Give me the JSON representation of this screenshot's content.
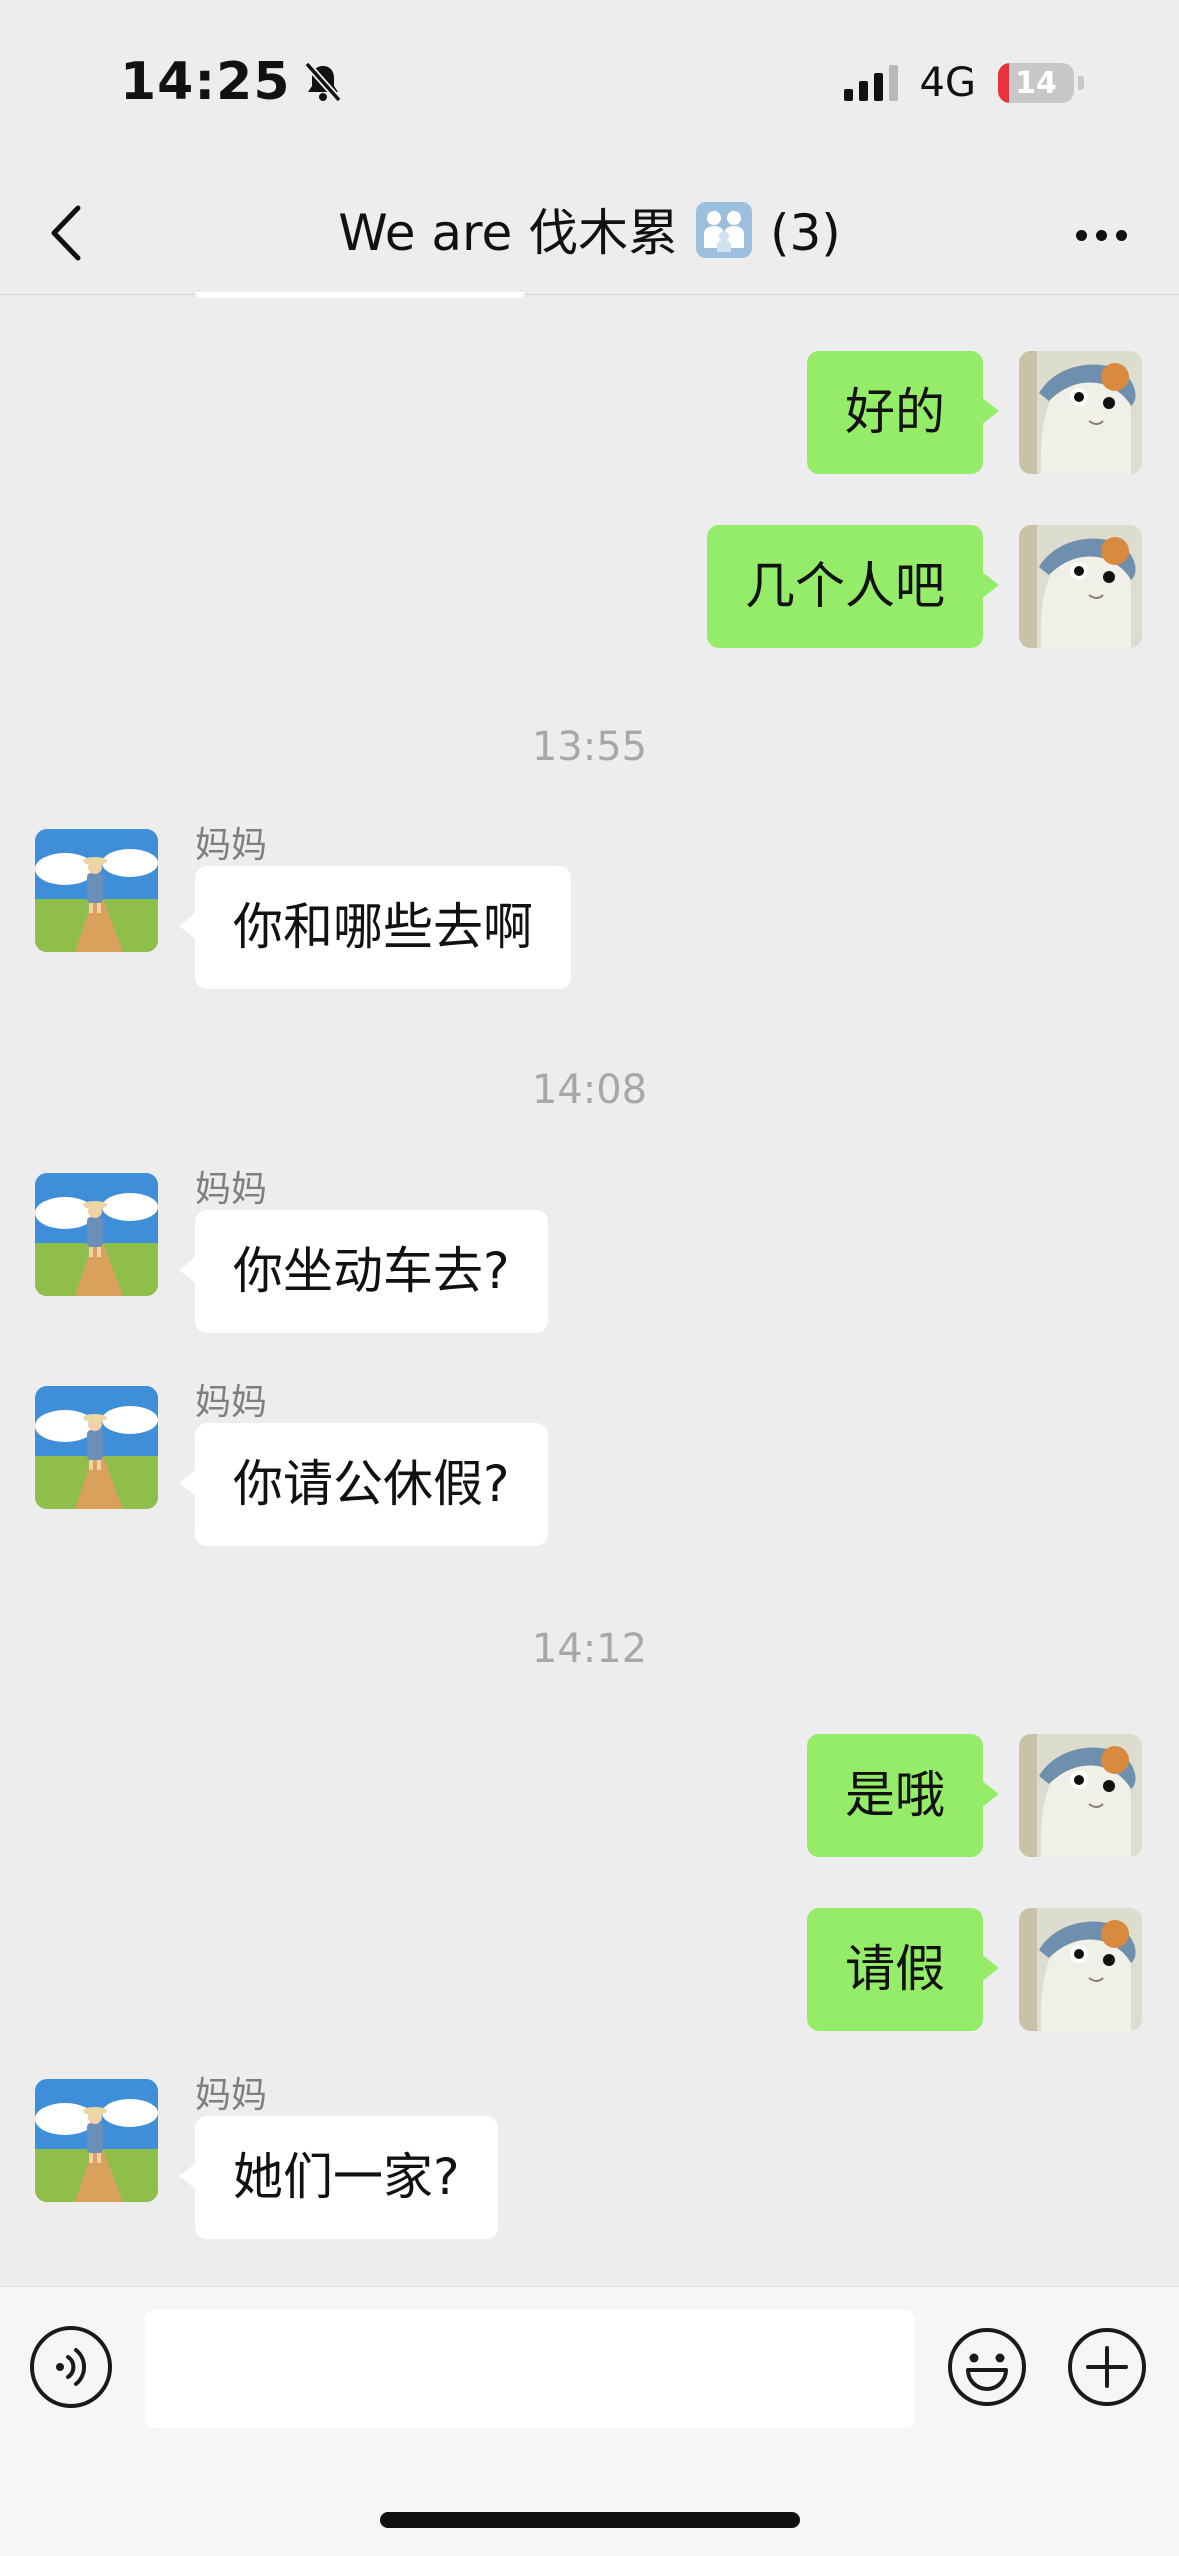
{
  "status_bar": {
    "time": "14:25",
    "network": "4G",
    "battery": "14",
    "battery_level": 0.14,
    "battery_color": "#e8323c",
    "icons": [
      "bell-muted-icon",
      "signal-icon",
      "battery-icon"
    ]
  },
  "header": {
    "title": "We are 伐木累",
    "title_icon": "family-emoji-icon",
    "member_count": "(3)"
  },
  "messages": [
    {
      "side": "me",
      "text": "好的"
    },
    {
      "side": "me",
      "text": "几个人吧"
    },
    {
      "timestamp": "13:55"
    },
    {
      "side": "mom",
      "sender": "妈妈",
      "text": "你和哪些去啊"
    },
    {
      "timestamp": "14:08"
    },
    {
      "side": "mom",
      "sender": "妈妈",
      "text": "你坐动车去?"
    },
    {
      "side": "mom",
      "sender": "妈妈",
      "text": "你请公休假?"
    },
    {
      "timestamp": "14:12"
    },
    {
      "side": "me",
      "text": "是哦"
    },
    {
      "side": "me",
      "text": "请假"
    },
    {
      "side": "mom",
      "sender": "妈妈",
      "text": "她们一家?"
    }
  ],
  "colors": {
    "background": "#ededed",
    "my_bubble": "#95ec69",
    "their_bubble": "#ffffff"
  },
  "input_bar": {
    "value": "",
    "icons": [
      "voice-icon",
      "emoji-icon",
      "plus-icon"
    ]
  }
}
